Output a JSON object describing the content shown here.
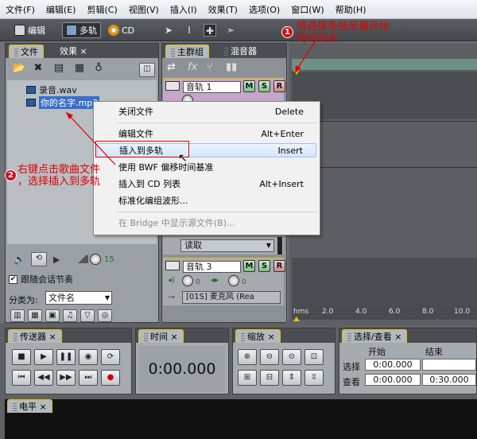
{
  "menubar": {
    "items": [
      "文件(F)",
      "编辑(E)",
      "剪辑(C)",
      "视图(V)",
      "插入(I)",
      "效果(T)",
      "选项(O)",
      "窗口(W)",
      "帮助(H)"
    ]
  },
  "toolbar": {
    "edit_label": "编辑",
    "multitrack_label": "多轨",
    "cd_label": "CD"
  },
  "file_panel": {
    "tabs": [
      "文件",
      "效果"
    ],
    "files": [
      "录音.wav",
      "你的名字.mp3"
    ],
    "bottom_value": "15",
    "follow_label": "跟随会话节奏",
    "sort_label": "分类为:",
    "sort_value": "文件名"
  },
  "tracks_panel": {
    "tabs": [
      "主群组",
      "混音器"
    ],
    "track1_name": "音轨 1",
    "track3_name": "音轨 3",
    "read_mode": "读取",
    "input_label": "[01S] 麦克风 (Rea",
    "knob_value": "0",
    "msr": [
      "M",
      "S",
      "R"
    ]
  },
  "timeline": {
    "ruler_labels": [
      "hms",
      "2.0",
      "4.0",
      "6.0",
      "8.0",
      "10.0"
    ]
  },
  "context_menu": {
    "items": [
      {
        "label": "关闭文件",
        "shortcut": "Delete"
      },
      {
        "label": "编辑文件",
        "shortcut": "Alt+Enter"
      },
      {
        "label": "插入到多轨",
        "shortcut": "Insert"
      },
      {
        "label": "使用 BWF 偏移时间基准",
        "shortcut": ""
      },
      {
        "label": "插入到 CD 列表",
        "shortcut": "Alt+Insert"
      },
      {
        "label": "标准化编组波形...",
        "shortcut": ""
      },
      {
        "label": "在 Bridge 中显示源文件(B)...",
        "shortcut": ""
      }
    ]
  },
  "annotations": {
    "note1_num": "1",
    "note1_line1": "将进度条拖至最开始",
    "note1_line2": "的时间点",
    "note2_num": "2",
    "note2_line1": "右键点击歌曲文件",
    "note2_line2": "，选择插入到多轨"
  },
  "transport": {
    "title": "传送器"
  },
  "time_panel": {
    "title": "时间",
    "display": "0:00.000"
  },
  "zoom_panel": {
    "title": "缩放"
  },
  "selection_panel": {
    "title": "选择/查看",
    "col_start": "开始",
    "col_end": "结束",
    "row_select": "选择",
    "row_view": "查看",
    "select_start": "0:00.000",
    "view_start": "0:00.000",
    "view_end": "0:30.000"
  },
  "level_panel": {
    "title": "电平"
  },
  "colors": {
    "accent_yellow": "#e9c100",
    "annotation_red": "#e00000"
  }
}
